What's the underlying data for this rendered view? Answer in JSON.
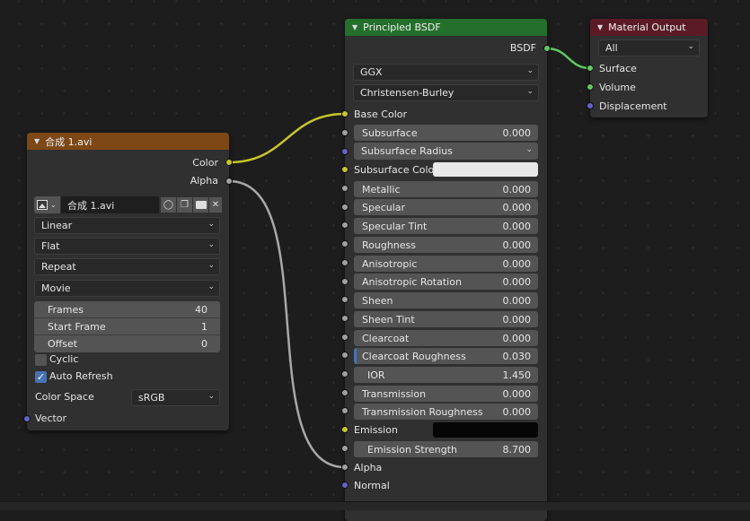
{
  "colors": {
    "image_header": "#7d4716",
    "bsdf_header": "#236f2b",
    "output_header": "#5b1b26",
    "socket_color": "#c7c729",
    "socket_float": "#a1a1a1",
    "socket_vector": "#6363c7",
    "socket_shader": "#63c763"
  },
  "image_node": {
    "title": "合成 1.avi",
    "outputs": {
      "color": "Color",
      "alpha": "Alpha"
    },
    "image_name": "合成 1.avi",
    "interpolation": "Linear",
    "projection": "Flat",
    "extension": "Repeat",
    "source": "Movie",
    "frames": {
      "label": "Frames",
      "value": "40"
    },
    "start_frame": {
      "label": "Start Frame",
      "value": "1"
    },
    "offset": {
      "label": "Offset",
      "value": "0"
    },
    "cyclic_label": "Cyclic",
    "auto_refresh_label": "Auto Refresh",
    "color_space_label": "Color Space",
    "color_space_value": "sRGB",
    "vector_label": "Vector"
  },
  "bsdf_node": {
    "title": "Principled BSDF",
    "output": "BSDF",
    "distribution": "GGX",
    "subsurface_method": "Christensen-Burley",
    "base_color": "Base Color",
    "subsurface": {
      "label": "Subsurface",
      "value": "0.000"
    },
    "subsurface_radius": "Subsurface Radius",
    "subsurface_color": "Subsurface Colo",
    "metallic": {
      "label": "Metallic",
      "value": "0.000"
    },
    "specular": {
      "label": "Specular",
      "value": "0.000"
    },
    "specular_tint": {
      "label": "Specular Tint",
      "value": "0.000"
    },
    "roughness": {
      "label": "Roughness",
      "value": "0.000"
    },
    "anisotropic": {
      "label": "Anisotropic",
      "value": "0.000"
    },
    "anisotropic_rotation": {
      "label": "Anisotropic Rotation",
      "value": "0.000"
    },
    "sheen": {
      "label": "Sheen",
      "value": "0.000"
    },
    "sheen_tint": {
      "label": "Sheen Tint",
      "value": "0.000"
    },
    "clearcoat": {
      "label": "Clearcoat",
      "value": "0.000"
    },
    "clearcoat_roughness": {
      "label": "Clearcoat Roughness",
      "value": "0.030"
    },
    "ior": {
      "label": "IOR",
      "value": "1.450"
    },
    "transmission": {
      "label": "Transmission",
      "value": "0.000"
    },
    "transmission_roughness": {
      "label": "Transmission Roughness",
      "value": "0.000"
    },
    "emission": "Emission",
    "emission_strength": {
      "label": "Emission Strength",
      "value": "8.700"
    },
    "alpha": "Alpha",
    "normal": "Normal"
  },
  "output_node": {
    "title": "Material Output",
    "target": "All",
    "surface": "Surface",
    "volume": "Volume",
    "displacement": "Displacement"
  }
}
